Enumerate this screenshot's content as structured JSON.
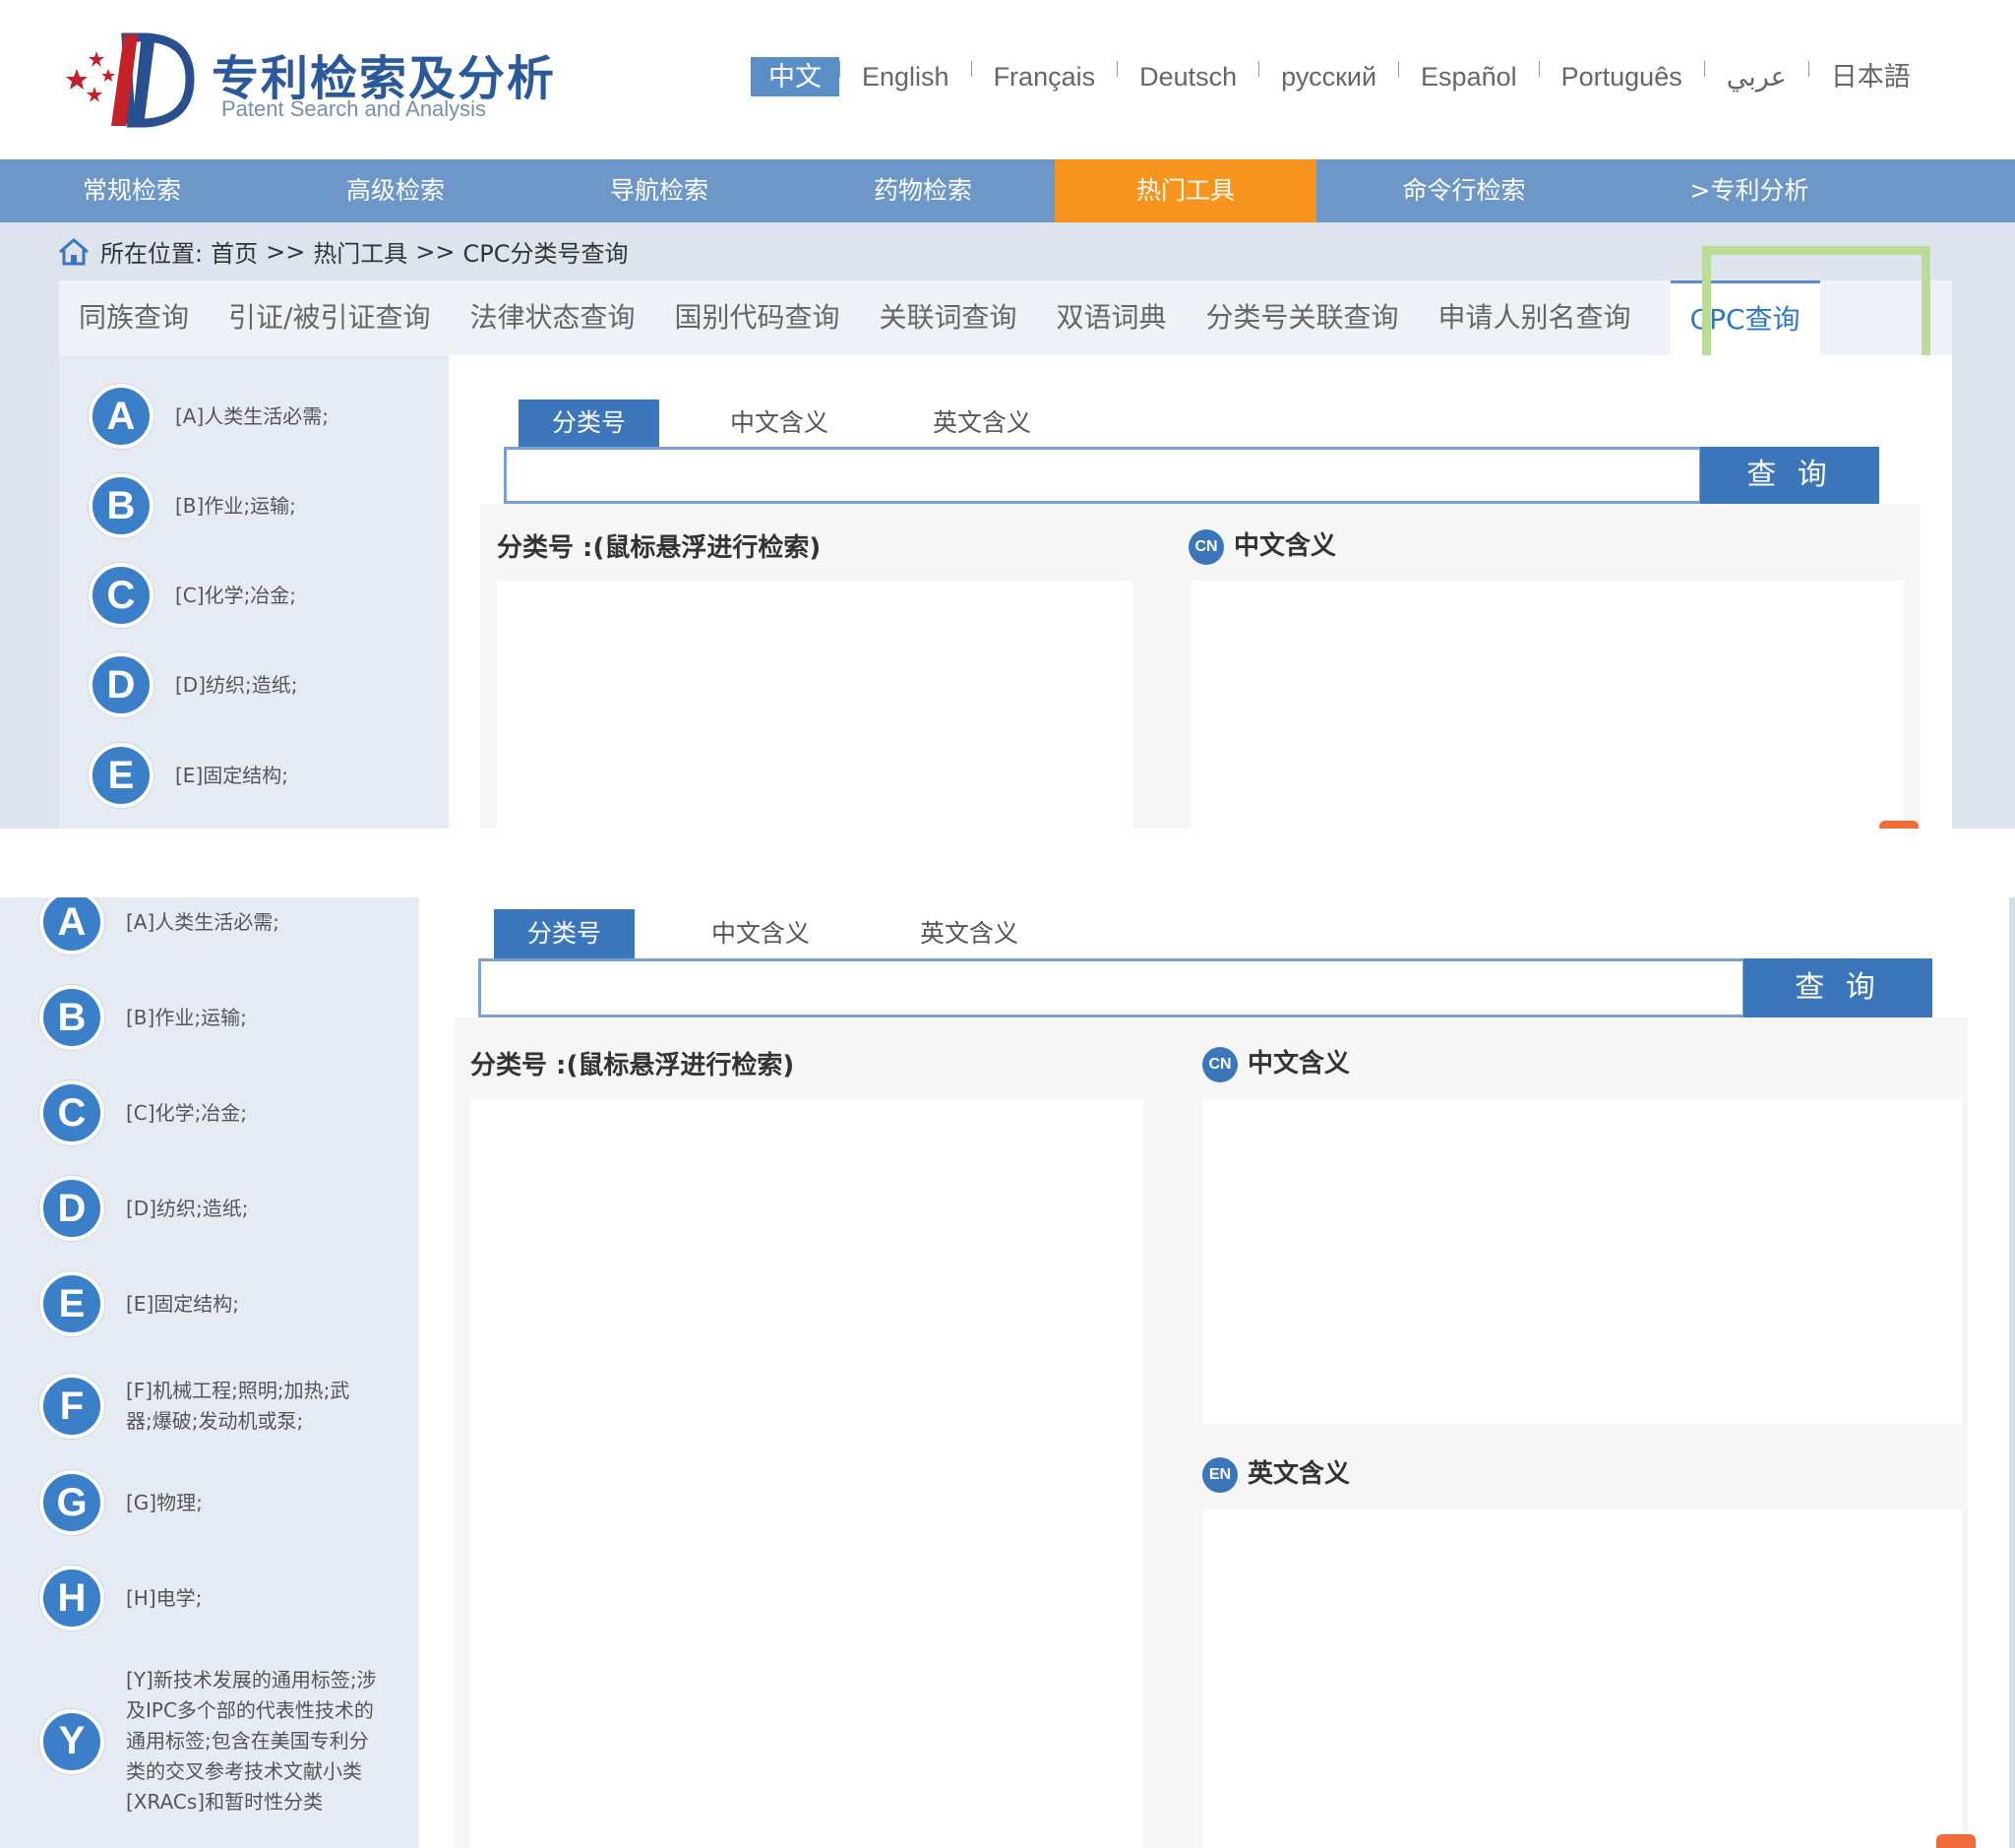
{
  "header": {
    "title": "专利检索及分析",
    "subtitle": "Patent Search and Analysis",
    "languages": [
      "中文",
      "English",
      "Français",
      "Deutsch",
      "русский",
      "Español",
      "Português",
      "عربي",
      "日本語"
    ]
  },
  "nav": {
    "items": [
      "常规检索",
      "高级检索",
      "导航检索",
      "药物检索",
      "热门工具",
      "命令行检索",
      ">专利分析"
    ]
  },
  "breadcrumb": {
    "label": "所在位置:",
    "home": "首页",
    "sep1": ">>",
    "level1": "热门工具",
    "sep2": ">>",
    "level2": "CPC分类号查询"
  },
  "tool_tabs": [
    "同族查询",
    "引证/被引证查询",
    "法律状态查询",
    "国别代码查询",
    "关联词查询",
    "双语词典",
    "分类号关联查询",
    "申请人别名查询",
    "CPC查询"
  ],
  "sections": [
    {
      "letter": "A",
      "text": "[A]人类生活必需;"
    },
    {
      "letter": "B",
      "text": "[B]作业;运输;"
    },
    {
      "letter": "C",
      "text": "[C]化学;冶金;"
    },
    {
      "letter": "D",
      "text": "[D]纺织;造纸;"
    },
    {
      "letter": "E",
      "text": "[E]固定结构;"
    },
    {
      "letter": "F",
      "text": "[F]机械工程;照明;加热;武器;爆破;发动机或泵;"
    },
    {
      "letter": "G",
      "text": "[G]物理;"
    },
    {
      "letter": "H",
      "text": "[H]电学;"
    },
    {
      "letter": "Y",
      "text": "[Y]新技术发展的通用标签;涉及IPC多个部的代表性技术的通用标签;包含在美国专利分类的交叉参考技术文献小类[XRACs]和暂时性分类"
    }
  ],
  "search": {
    "tabs": [
      "分类号",
      "中文含义",
      "英文含义"
    ],
    "button": "查 询",
    "input_value": ""
  },
  "results": {
    "class_title": "分类号 :(鼠标悬浮进行检索)",
    "cn_badge": "CN",
    "cn_title": "中文含义",
    "en_badge": "EN",
    "en_title": "英文含义"
  },
  "colors": {
    "nav_bg": "#6d97c6",
    "nav_active": "#f7941d",
    "accent_blue": "#3a76b9",
    "highlight_green": "#b9dc96"
  }
}
